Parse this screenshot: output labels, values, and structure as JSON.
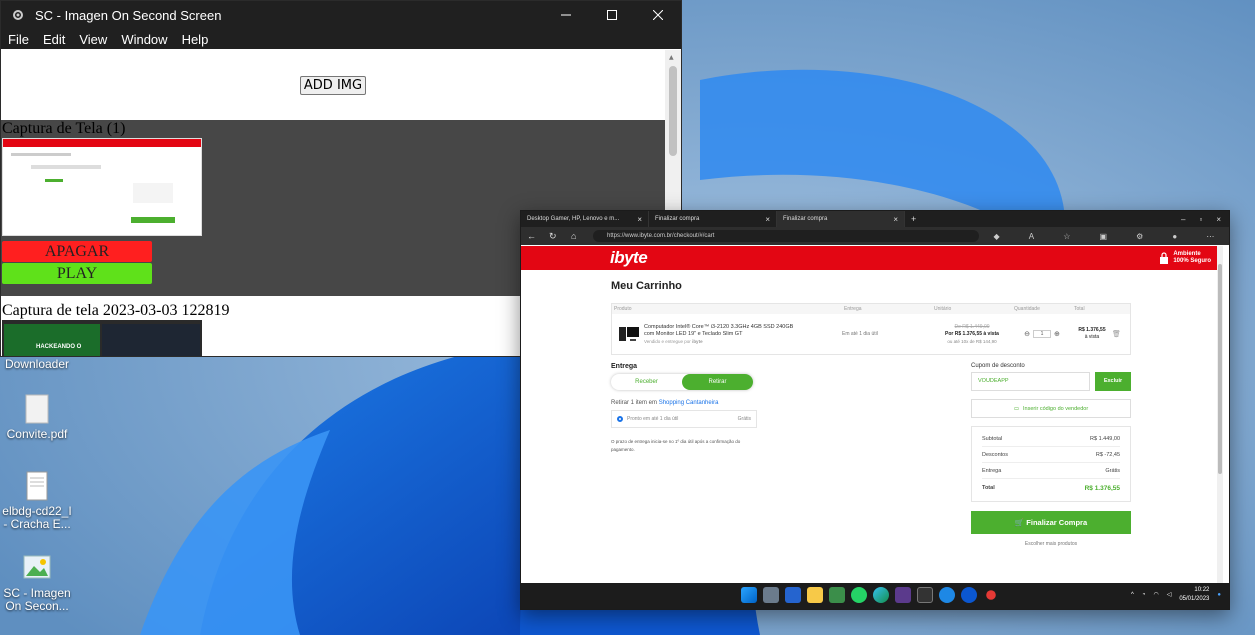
{
  "app": {
    "title": "SC - Imagen On Second Screen",
    "menu": [
      "File",
      "Edit",
      "View",
      "Window",
      "Help"
    ],
    "add_button": "ADD IMG",
    "captures": [
      {
        "title": "Captura de Tela (1)",
        "delete_label": "APAGAR",
        "play_label": "PLAY"
      },
      {
        "title": "Captura de tela 2023-03-03 122819"
      }
    ],
    "thumb2_text": "HACKEANDO O"
  },
  "desktop": {
    "icons": [
      {
        "label": "SC Youtube Downloader",
        "label_line1": "Downloader"
      },
      {
        "label": "Convite.pdf"
      },
      {
        "label_line1": "elbdg-cd22_I",
        "label_line2": "- Cracha E..."
      },
      {
        "label_line1": "SC - Imagen",
        "label_line2": "On Secon..."
      }
    ]
  },
  "browser": {
    "tabs": [
      {
        "label": "Desktop Gamer, HP, Lenovo e m..."
      },
      {
        "label": "Finalizar compra"
      },
      {
        "label": "Finalizar compra"
      }
    ],
    "url": "https://www.ibyte.com.br/checkout/#/cart",
    "site": {
      "logo": "ibyte",
      "secure_line1": "Ambiente",
      "secure_line2": "100% Seguro",
      "title": "Meu Carrinho",
      "columns": [
        "Produto",
        "Entrega",
        "Unitário",
        "Quantidade",
        "Total"
      ],
      "item": {
        "name_line1": "Computador Intel® Core™ i3-2120 3.3GHz 4GB SSD 240GB",
        "name_line2": "com Monitor LED 19\" e Teclado Slim GT",
        "seller_prefix": "Vendido e entregue por",
        "seller": "ibyte",
        "delivery": "Em até 1 dia útil",
        "old_price": "De R$ 1.449,00",
        "price": "Por R$ 1.376,55 à vista",
        "installments": "ou até 10x de R$ 144,90",
        "qty": "1",
        "total_line1": "R$ 1.376,55",
        "total_line2": "à vista"
      },
      "delivery_title": "Entrega",
      "toggle_receive": "Receber",
      "toggle_pickup": "Retirar",
      "pickup_text": "Retirar 1 item em",
      "pickup_store": "Shopping Cantanheira",
      "pickup_option": "Pronto em até 1 dia útil",
      "pickup_price": "Grátis",
      "note_line1": "O prazo de entrega inicia-se no 1º dia útil após a confirmação do",
      "note_line2": "pagamento.",
      "coupon_label": "Cupom de desconto",
      "coupon_value": "VOUDEAPP",
      "coupon_button": "Excluir",
      "seller_code": "Inserir código do vendedor",
      "summary": [
        {
          "label": "Subtotal",
          "value": "R$ 1.449,00"
        },
        {
          "label": "Descontos",
          "value": "R$ -72,45"
        },
        {
          "label": "Entrega",
          "value": "Grátis"
        },
        {
          "label": "Total",
          "value": "R$ 1.376,55"
        }
      ],
      "checkout_button": "Finalizar Compra",
      "continue_link": "Escolher mais produtos"
    },
    "taskbar": {
      "time": "10:22",
      "date": "05/01/2023"
    }
  },
  "colors": {
    "red": "#e30613",
    "green": "#4caf2f",
    "delete": "#ff1f1f",
    "play": "#5fe11a"
  }
}
